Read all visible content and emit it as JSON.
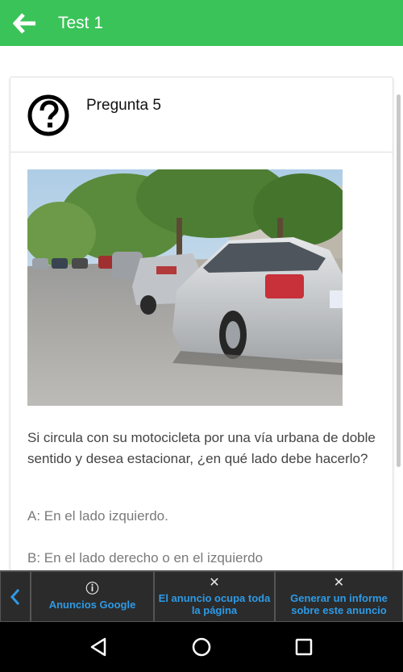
{
  "appbar": {
    "title": "Test 1",
    "back_icon": "arrow-left-icon",
    "color": "#3ac358"
  },
  "question": {
    "icon": "question-circle-icon",
    "title": "Pregunta 5",
    "text": "Si circula con su motocicleta por una vía urbana de doble sentido y desea estacionar, ¿en qué lado debe hacerlo?",
    "options": [
      "A: En el lado izquierdo.",
      "B: En el lado derecho o en el izquierdo"
    ]
  },
  "ad_bar": {
    "back_icon": "chevron-left-icon",
    "google": {
      "icon": "info-icon",
      "label": "Anuncios Google"
    },
    "fullpage": {
      "icon": "close-icon",
      "label": "El anuncio ocupa toda la página"
    },
    "report": {
      "icon": "close-icon",
      "label": "Generar un informe sobre este anuncio"
    },
    "accent": "#2d9ae6"
  },
  "navbar": {
    "back": "nav-back-icon",
    "home": "nav-home-icon",
    "recents": "nav-recents-icon"
  }
}
